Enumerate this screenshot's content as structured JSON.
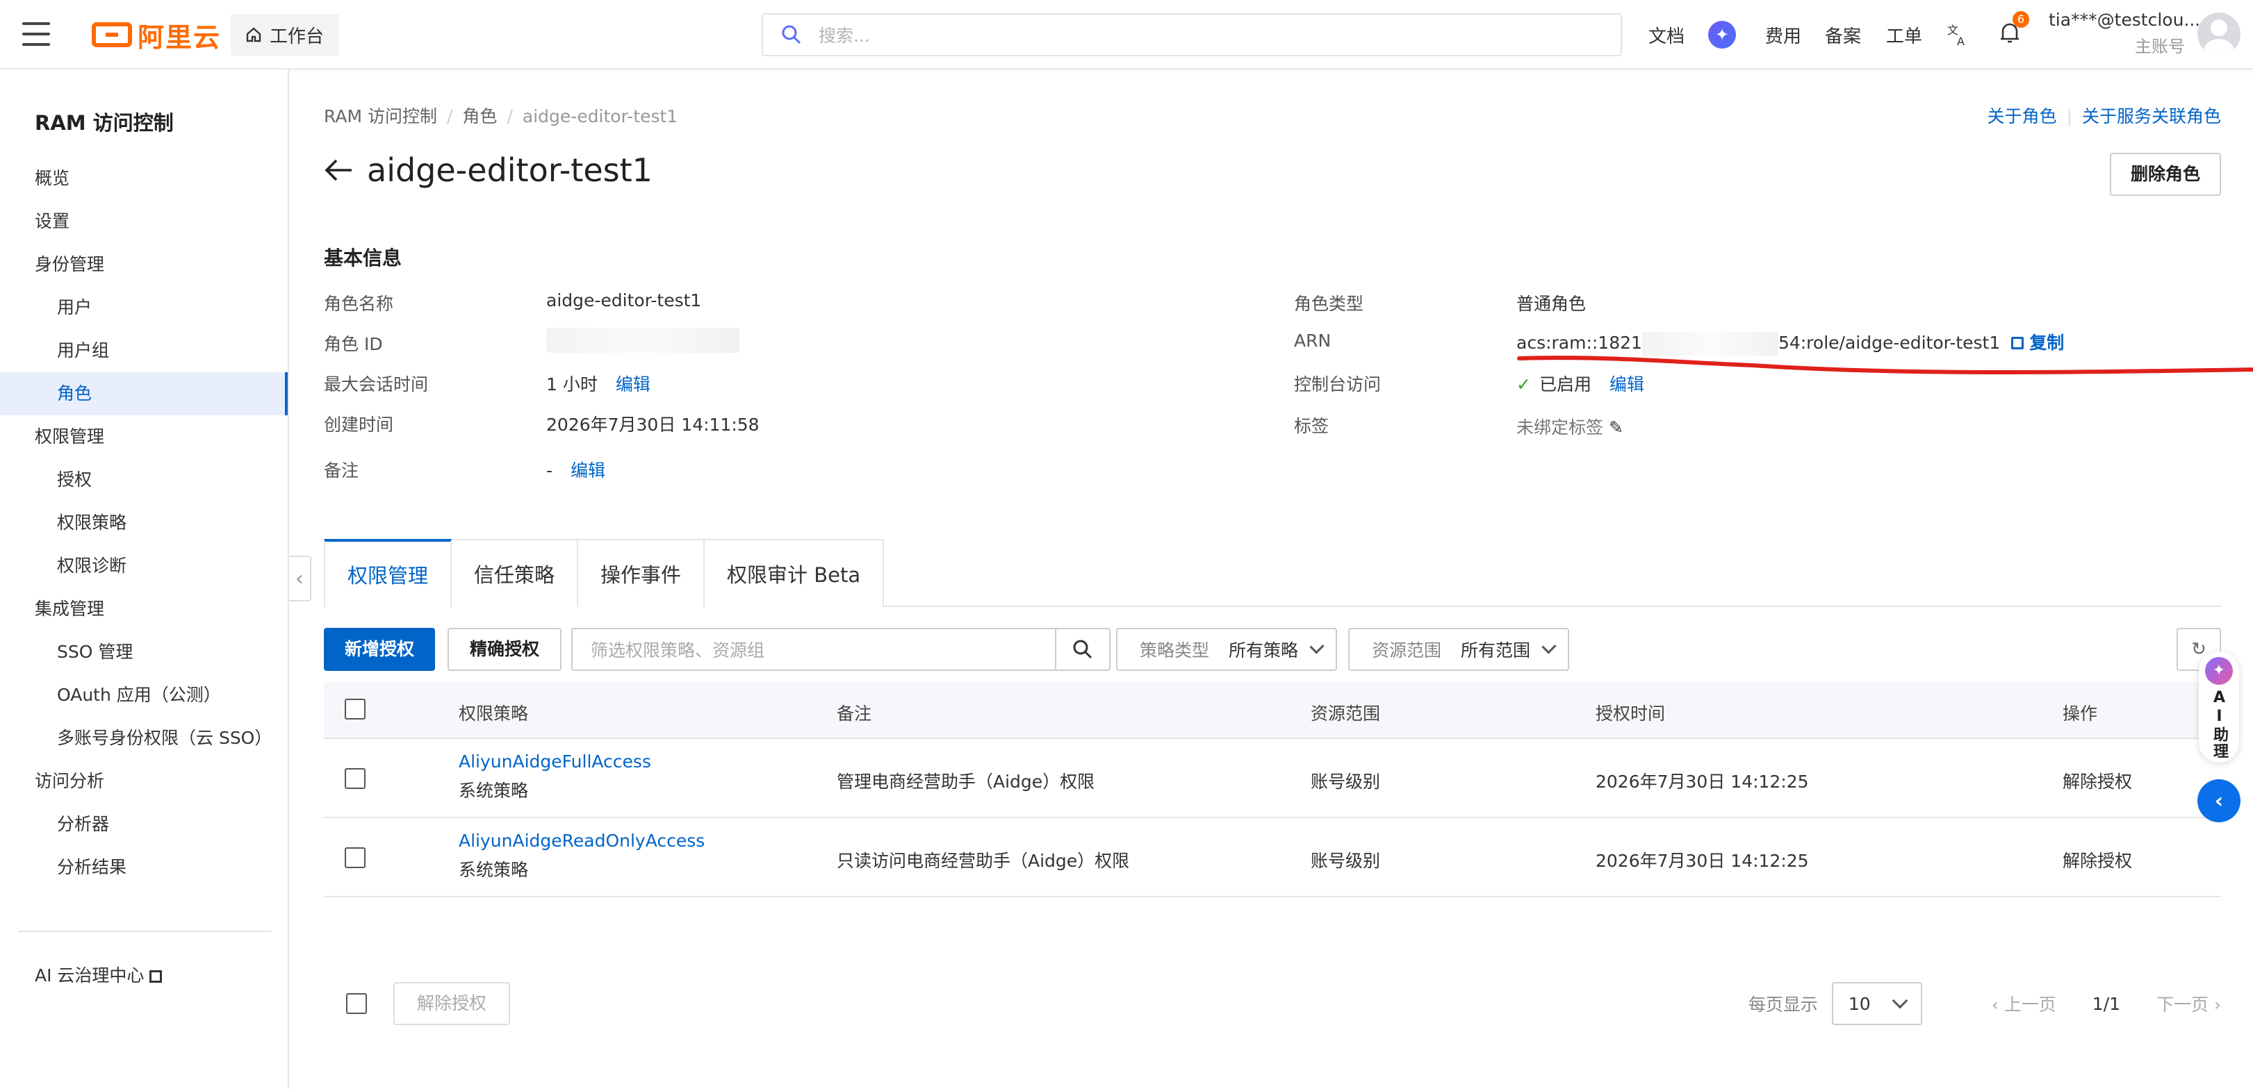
{
  "topbar": {
    "logo_text": "阿里云",
    "workbench": "工作台",
    "search_placeholder": "搜索...",
    "nav": [
      "文档",
      "费用",
      "备案",
      "工单"
    ],
    "notification_count": "6",
    "account_email": "tia***@testclou...",
    "account_type": "主账号"
  },
  "sidebar": {
    "title": "RAM 访问控制",
    "items": [
      {
        "label": "概览"
      },
      {
        "label": "设置"
      },
      {
        "label": "身份管理"
      },
      {
        "label": "用户"
      },
      {
        "label": "用户组"
      },
      {
        "label": "角色"
      },
      {
        "label": "权限管理"
      },
      {
        "label": "授权"
      },
      {
        "label": "权限策略"
      },
      {
        "label": "权限诊断"
      },
      {
        "label": "集成管理"
      },
      {
        "label": "SSO 管理"
      },
      {
        "label": "OAuth 应用（公测）"
      },
      {
        "label": "多账号身份权限（云 SSO）"
      },
      {
        "label": "访问分析"
      },
      {
        "label": "分析器"
      },
      {
        "label": "分析结果"
      }
    ],
    "footer_link": "AI 云治理中心"
  },
  "breadcrumb": [
    "RAM 访问控制",
    "角色",
    "aidge-editor-test1"
  ],
  "top_links": [
    "关于角色",
    "关于服务关联角色"
  ],
  "page": {
    "title": "aidge-editor-test1",
    "delete_button": "删除角色"
  },
  "basic_info": {
    "title": "基本信息",
    "left": {
      "role_name_label": "角色名称",
      "role_name": "aidge-editor-test1",
      "role_id_label": "角色 ID",
      "max_session_label": "最大会话时间",
      "max_session": "1 小时",
      "created_label": "创建时间",
      "created": "2026年7月30日 14:11:58",
      "note_label": "备注",
      "note": "-",
      "edit": "编辑"
    },
    "right": {
      "role_type_label": "角色类型",
      "role_type": "普通角色",
      "arn_label": "ARN",
      "arn_prefix": "acs:ram::1821",
      "arn_suffix": "54:role/aidge-editor-test1",
      "copy": "复制",
      "console_label": "控制台访问",
      "console_status": "已启用",
      "edit": "编辑",
      "tags_label": "标签",
      "tags_value": "未绑定标签"
    }
  },
  "tabs": [
    "权限管理",
    "信任策略",
    "操作事件",
    "权限审计 Beta"
  ],
  "toolbar": {
    "add_button": "新增授权",
    "precise_button": "精确授权",
    "filter_placeholder": "筛选权限策略、资源组",
    "policy_type_label": "策略类型",
    "policy_type_value": "所有策略",
    "scope_label": "资源范围",
    "scope_value": "所有范围"
  },
  "table": {
    "headers": [
      "权限策略",
      "备注",
      "资源范围",
      "授权时间",
      "操作"
    ],
    "rows": [
      {
        "policy": "AliyunAidgeFullAccess",
        "type": "系统策略",
        "note": "管理电商经营助手（Aidge）权限",
        "scope": "账号级别",
        "time": "2026年7月30日 14:12:25",
        "action": "解除授权"
      },
      {
        "policy": "AliyunAidgeReadOnlyAccess",
        "type": "系统策略",
        "note": "只读访问电商经营助手（Aidge）权限",
        "scope": "账号级别",
        "time": "2026年7月30日 14:12:25",
        "action": "解除授权"
      }
    ]
  },
  "footer": {
    "batch_revoke": "解除授权",
    "per_page_label": "每页显示",
    "per_page": "10",
    "prev": "上一页",
    "page_info": "1/1",
    "next": "下一页"
  },
  "ai_assistant": "AI助理",
  "colors": {
    "brand": "#ff6a00",
    "primary": "#0064c8",
    "annotation": "#e0201b"
  }
}
